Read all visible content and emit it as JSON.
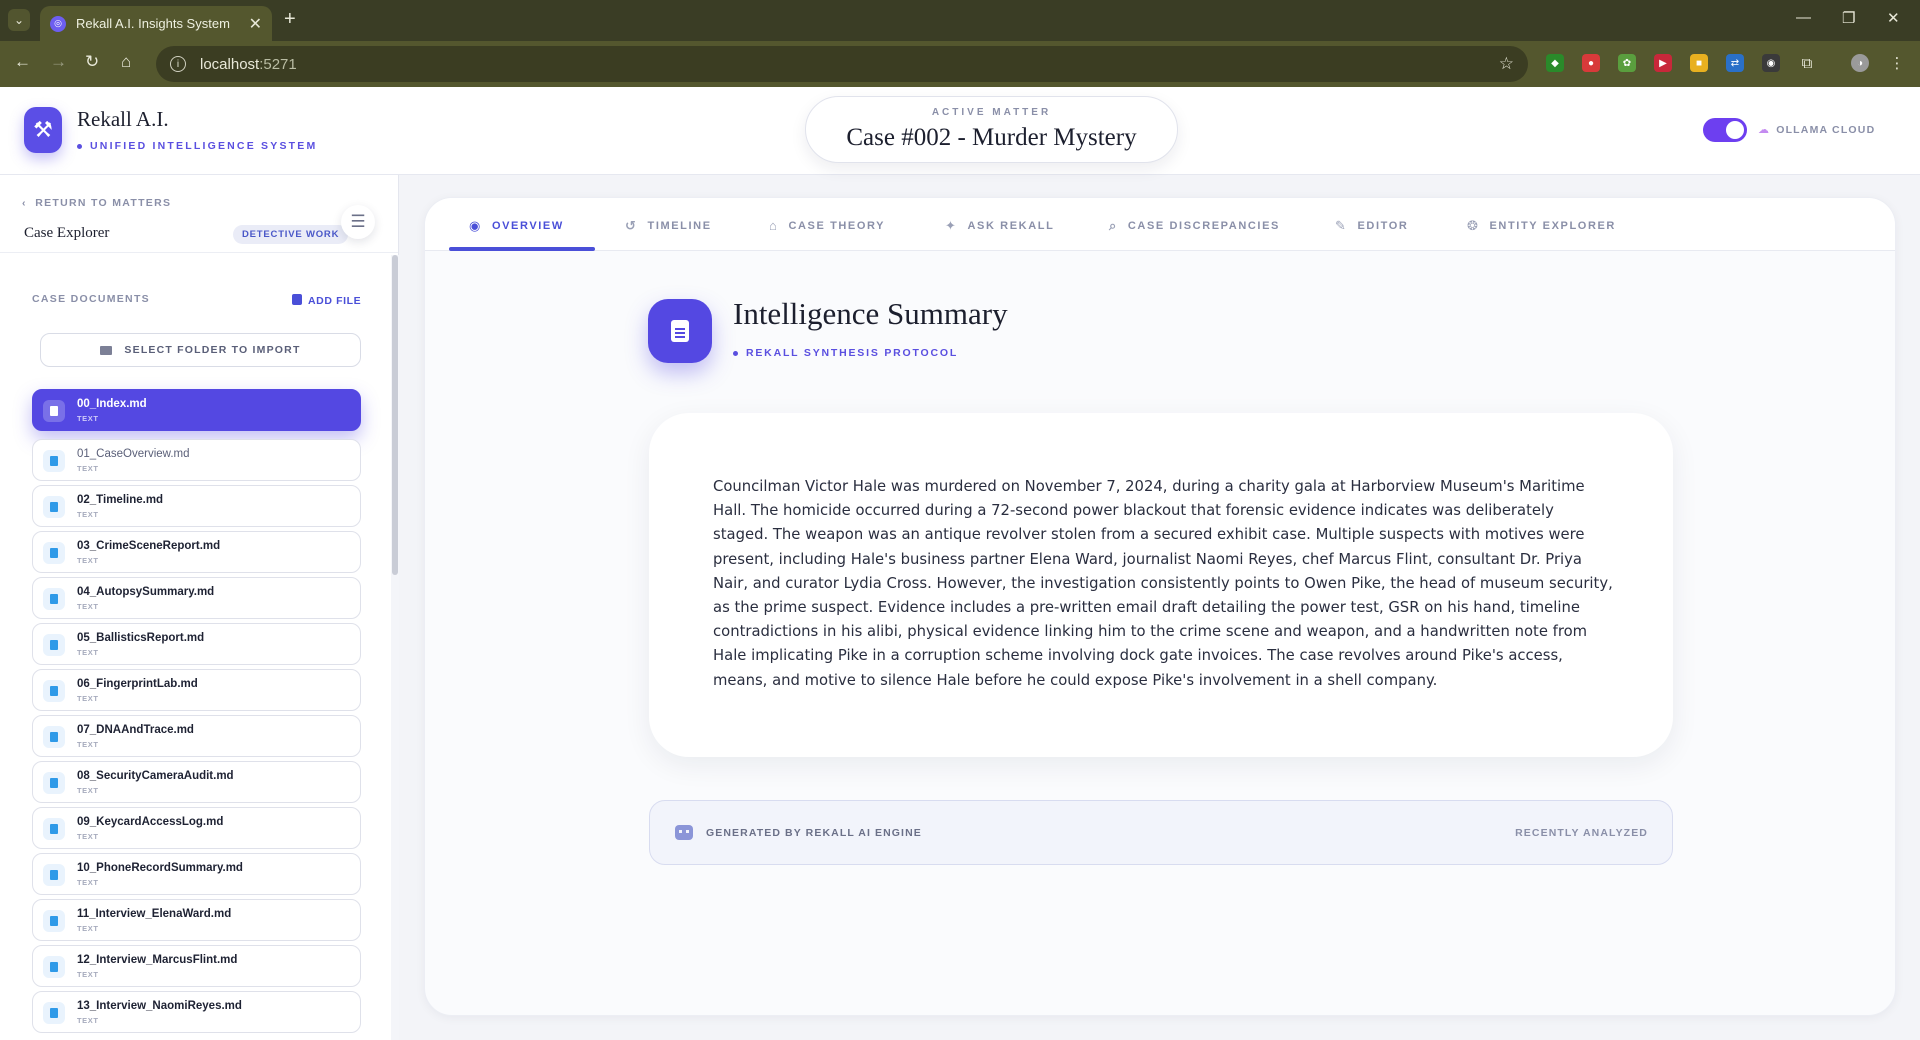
{
  "browser": {
    "tab_title": "Rekall A.I. Insights System",
    "url_host": "localhost",
    "url_port": ":5271"
  },
  "header": {
    "app_name": "Rekall A.I.",
    "app_subtitle": "UNIFIED INTELLIGENCE SYSTEM",
    "active_matter_label": "ACTIVE MATTER",
    "active_matter_title": "Case #002 - Murder Mystery",
    "provider_label": "OLLAMA CLOUD",
    "provider_toggle_on": true
  },
  "sidebar": {
    "back_label": "RETURN TO MATTERS",
    "title": "Case Explorer",
    "badge": "DETECTIVE WORK",
    "docs_label": "CASE DOCUMENTS",
    "add_file_label": "ADD FILE",
    "select_folder_label": "SELECT FOLDER TO IMPORT",
    "files": [
      {
        "name": "00_Index.md",
        "type": "TEXT"
      },
      {
        "name": "01_CaseOverview.md",
        "type": "TEXT"
      },
      {
        "name": "02_Timeline.md",
        "type": "TEXT"
      },
      {
        "name": "03_CrimeSceneReport.md",
        "type": "TEXT"
      },
      {
        "name": "04_AutopsySummary.md",
        "type": "TEXT"
      },
      {
        "name": "05_BallisticsReport.md",
        "type": "TEXT"
      },
      {
        "name": "06_FingerprintLab.md",
        "type": "TEXT"
      },
      {
        "name": "07_DNAAndTrace.md",
        "type": "TEXT"
      },
      {
        "name": "08_SecurityCameraAudit.md",
        "type": "TEXT"
      },
      {
        "name": "09_KeycardAccessLog.md",
        "type": "TEXT"
      },
      {
        "name": "10_PhoneRecordSummary.md",
        "type": "TEXT"
      },
      {
        "name": "11_Interview_ElenaWard.md",
        "type": "TEXT"
      },
      {
        "name": "12_Interview_MarcusFlint.md",
        "type": "TEXT"
      },
      {
        "name": "13_Interview_NaomiReyes.md",
        "type": "TEXT"
      }
    ]
  },
  "tabs": [
    {
      "label": "OVERVIEW",
      "icon": "eye-icon"
    },
    {
      "label": "TIMELINE",
      "icon": "history-icon"
    },
    {
      "label": "CASE THEORY",
      "icon": "landmark-icon"
    },
    {
      "label": "ASK REKALL",
      "icon": "magic-wand-icon"
    },
    {
      "label": "CASE DISCREPANCIES",
      "icon": "search-icon"
    },
    {
      "label": "EDITOR",
      "icon": "pencil-icon"
    },
    {
      "label": "ENTITY EXPLORER",
      "icon": "brain-icon"
    }
  ],
  "main": {
    "title": "Intelligence Summary",
    "subtitle": "REKALL SYNTHESIS PROTOCOL",
    "summary": "Councilman Victor Hale was murdered on November 7, 2024, during a charity gala at Harborview Museum's Maritime Hall. The homicide occurred during a 72-second power blackout that forensic evidence indicates was deliberately staged. The weapon was an antique revolver stolen from a secured exhibit case. Multiple suspects with motives were present, including Hale's business partner Elena Ward, journalist Naomi Reyes, chef Marcus Flint, consultant Dr. Priya Nair, and curator Lydia Cross. However, the investigation consistently points to Owen Pike, the head of museum security, as the prime suspect. Evidence includes a pre-written email draft detailing the power test, GSR on his hand, timeline contradictions in his alibi, physical evidence linking him to the crime scene and weapon, and a handwritten note from Hale implicating Pike in a corruption scheme involving dock gate invoices. The case revolves around Pike's access, means, and motive to silence Hale before he could expose Pike's involvement in a shell company.",
    "footer_generated": "GENERATED BY REKALL AI ENGINE",
    "footer_status": "RECENTLY ANALYZED"
  },
  "colors": {
    "accent": "#5448e2",
    "browser_frame": "#54572e"
  }
}
